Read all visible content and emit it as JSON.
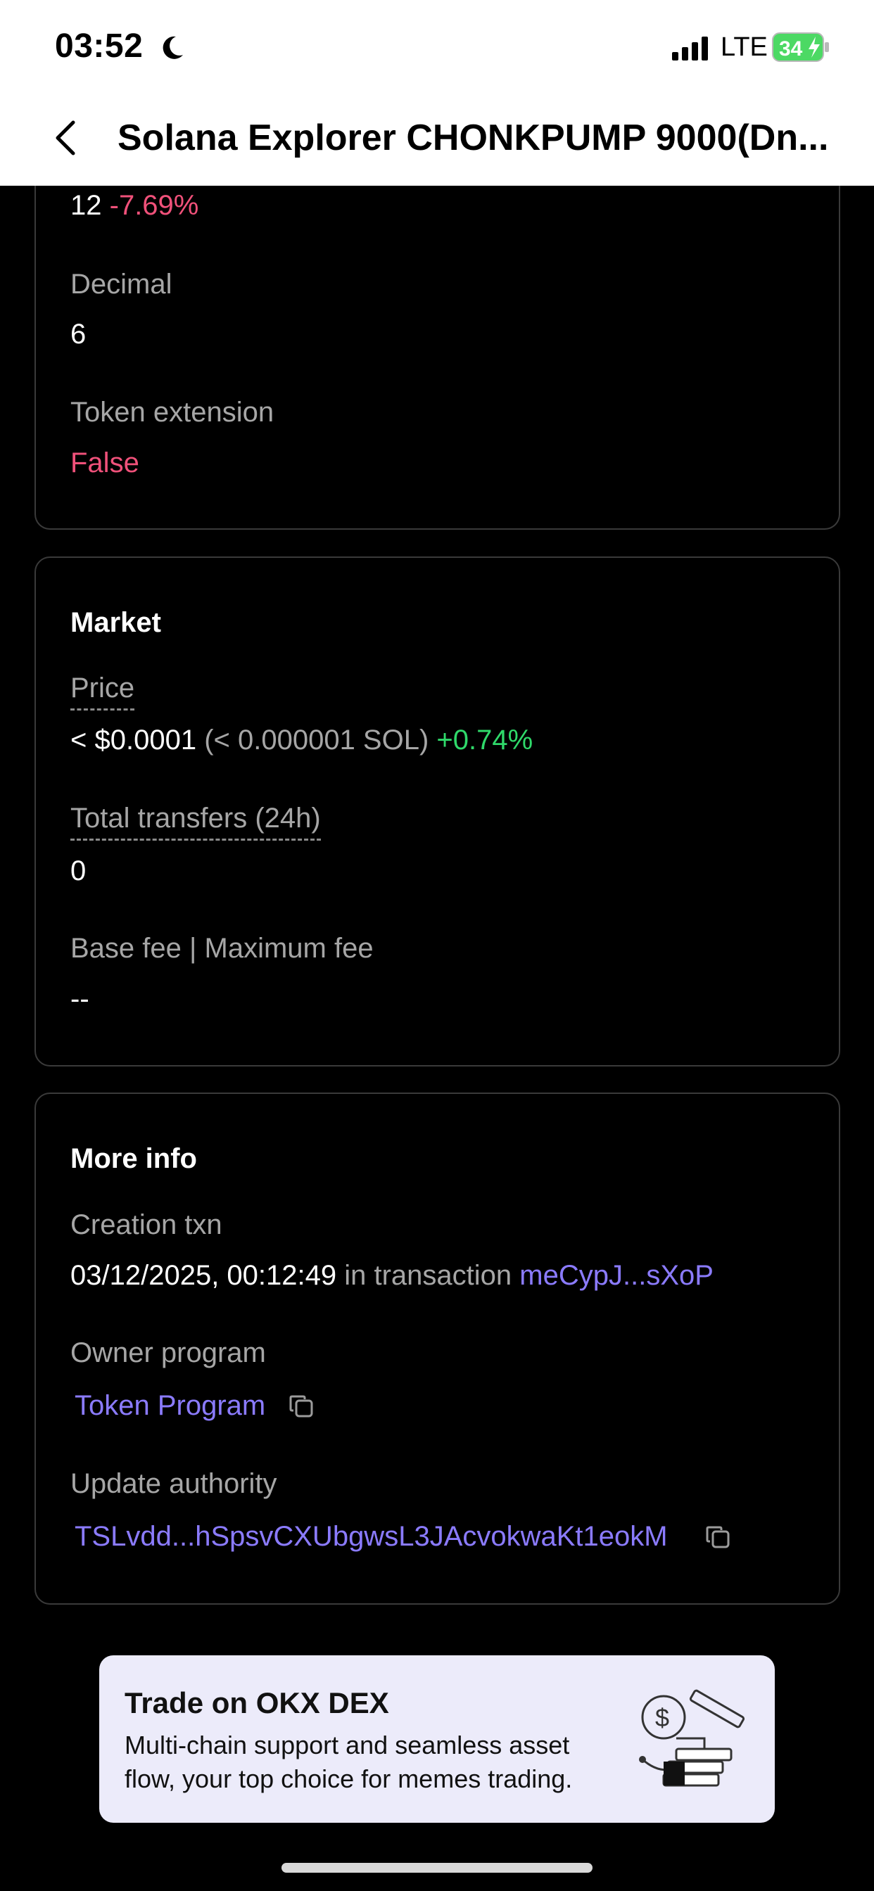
{
  "status_bar": {
    "time": "03:52",
    "network": "LTE",
    "battery": "34",
    "icons": [
      "moon-icon",
      "signal-icon",
      "battery-icon"
    ]
  },
  "header": {
    "title": "Solana Explorer CHONKPUMP 9000(Dn...",
    "back_icon": "chevron-left-icon"
  },
  "token_card": {
    "holders_value": "12",
    "holders_change": "-7.69%",
    "decimal_label": "Decimal",
    "decimal_value": "6",
    "extension_label": "Token extension",
    "extension_value": "False"
  },
  "market_card": {
    "title": "Market",
    "price_label": "Price",
    "price_value": "< $0.0001",
    "price_sol": "(< 0.000001 SOL)",
    "price_change": "+0.74%",
    "transfers_label": "Total transfers (24h)",
    "transfers_value": "0",
    "fee_label": "Base fee | Maximum fee",
    "fee_value": "--"
  },
  "more_info_card": {
    "title": "More info",
    "creation_label": "Creation txn",
    "creation_date": "03/12/2025, 00:12:49",
    "creation_in": "in transaction",
    "creation_tx": "meCypJ...sXoP",
    "owner_label": "Owner program",
    "owner_value": "Token Program",
    "authority_label": "Update authority",
    "authority_value": "TSLvdd...hSpsvCXUbgwsL3JAcvokwaKt1eokM"
  },
  "promo": {
    "title": "Trade on OKX DEX",
    "description": "Multi-chain support and seamless asset flow, your top choice for memes trading."
  },
  "colors": {
    "negative": "#f0517a",
    "positive": "#2fd96a",
    "link": "#8b7bff",
    "promo_bg": "#ecebfa"
  }
}
